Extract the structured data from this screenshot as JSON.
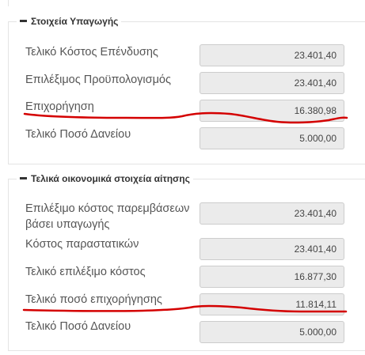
{
  "section1": {
    "title": "Στοιχεία Υπαγωγής",
    "rows": [
      {
        "label": "Τελικό Κόστος Επένδυσης",
        "value": "23.401,40"
      },
      {
        "label": "Επιλέξιμος Προϋπολογισμός",
        "value": "23.401,40"
      },
      {
        "label": "Επιχορήγηση",
        "value": "16.380,98"
      },
      {
        "label": "Τελικό Ποσό Δανείου",
        "value": "5.000,00"
      }
    ]
  },
  "section2": {
    "title": "Τελικά οικονομικά στοιχεία αίτησης",
    "rows": [
      {
        "label": "Επιλέξιμο κόστος παρεμβάσεων βάσει υπαγωγής",
        "value": "23.401,40"
      },
      {
        "label": "Κόστος παραστατικών",
        "value": "23.401,40"
      },
      {
        "label": "Τελικό επιλέξιμο κόστος",
        "value": "16.877,30"
      },
      {
        "label": "Τελικό ποσό επιχορήγησης",
        "value": "11.814,11"
      },
      {
        "label": "Τελικό Ποσό Δανείου",
        "value": "5.000,00"
      }
    ]
  },
  "colors": {
    "annotation": "#d40000",
    "field_bg": "#ebebeb",
    "field_border": "#cccccc"
  }
}
